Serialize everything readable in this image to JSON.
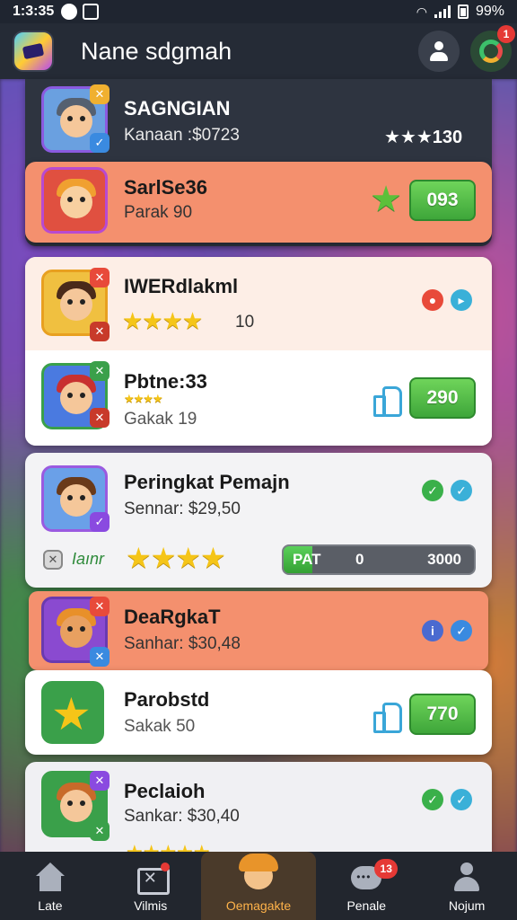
{
  "status_bar": {
    "time": "1:3:35",
    "battery": "99%"
  },
  "header": {
    "title": "Nane sdgmah",
    "notif_count": "1"
  },
  "top_card": {
    "title": "SAGNGIAN",
    "subtitle": "Kanaan :$0723",
    "rating_text": "★★★130",
    "featured": {
      "name": "SarlSe36",
      "sub": "Parak 90",
      "button": "093"
    }
  },
  "players": [
    {
      "name": "IWERdlakml",
      "rating_value": "10",
      "stars": "★★★★"
    },
    {
      "name": "Pbtne:33",
      "sub": "Gakak 19",
      "button": "290"
    },
    {
      "name": "Peringkat Pemajn",
      "sub": "Sennar: $29,50",
      "tag": "Iaınr",
      "stars": "★★★★",
      "progress_left": "PAT",
      "progress_mid": "0",
      "progress_right": "3000",
      "progress_fraction": 0.15
    },
    {
      "name": "DeaRgkaT",
      "sub": "Sanhar: $30,48"
    },
    {
      "name": "Parobstd",
      "sub": "Sakak 50",
      "button": "770"
    },
    {
      "name": "Peclaioh",
      "sub": "Sankar: $30,40"
    }
  ],
  "bottom_nav": {
    "items": [
      {
        "label": "Late"
      },
      {
        "label": "Vilmis"
      },
      {
        "label": "Oemagakte"
      },
      {
        "label": "Penale",
        "badge": "13"
      },
      {
        "label": "Nojum"
      }
    ]
  },
  "colors": {
    "accent_green": "#3ea63a",
    "highlight_orange": "#f4906e",
    "header_bg": "#252b36"
  }
}
